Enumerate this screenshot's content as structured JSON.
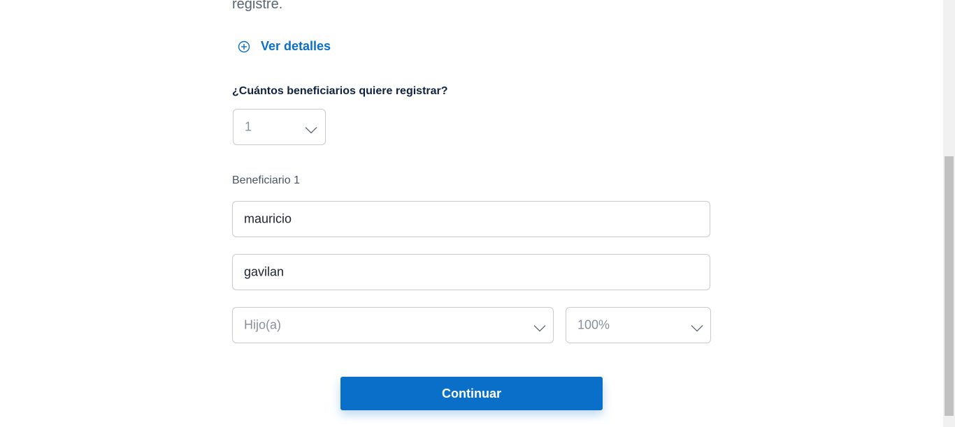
{
  "intro": {
    "tail_text": "registre."
  },
  "details_link": {
    "label": "Ver detalles",
    "icon": "plus-circle-icon"
  },
  "beneficiaries_question": {
    "label": "¿Cuántos beneficiarios quiere registrar?",
    "selected": "1"
  },
  "beneficiary": {
    "section_label": "Beneficiario 1",
    "first_name": "mauricio",
    "last_name": "gavilan",
    "relationship": "Hijo(a)",
    "percentage": "100%"
  },
  "actions": {
    "continue_label": "Continuar"
  },
  "colors": {
    "accent": "#0a6fc9",
    "border": "#c7ccd3",
    "heading": "#0f2340"
  }
}
